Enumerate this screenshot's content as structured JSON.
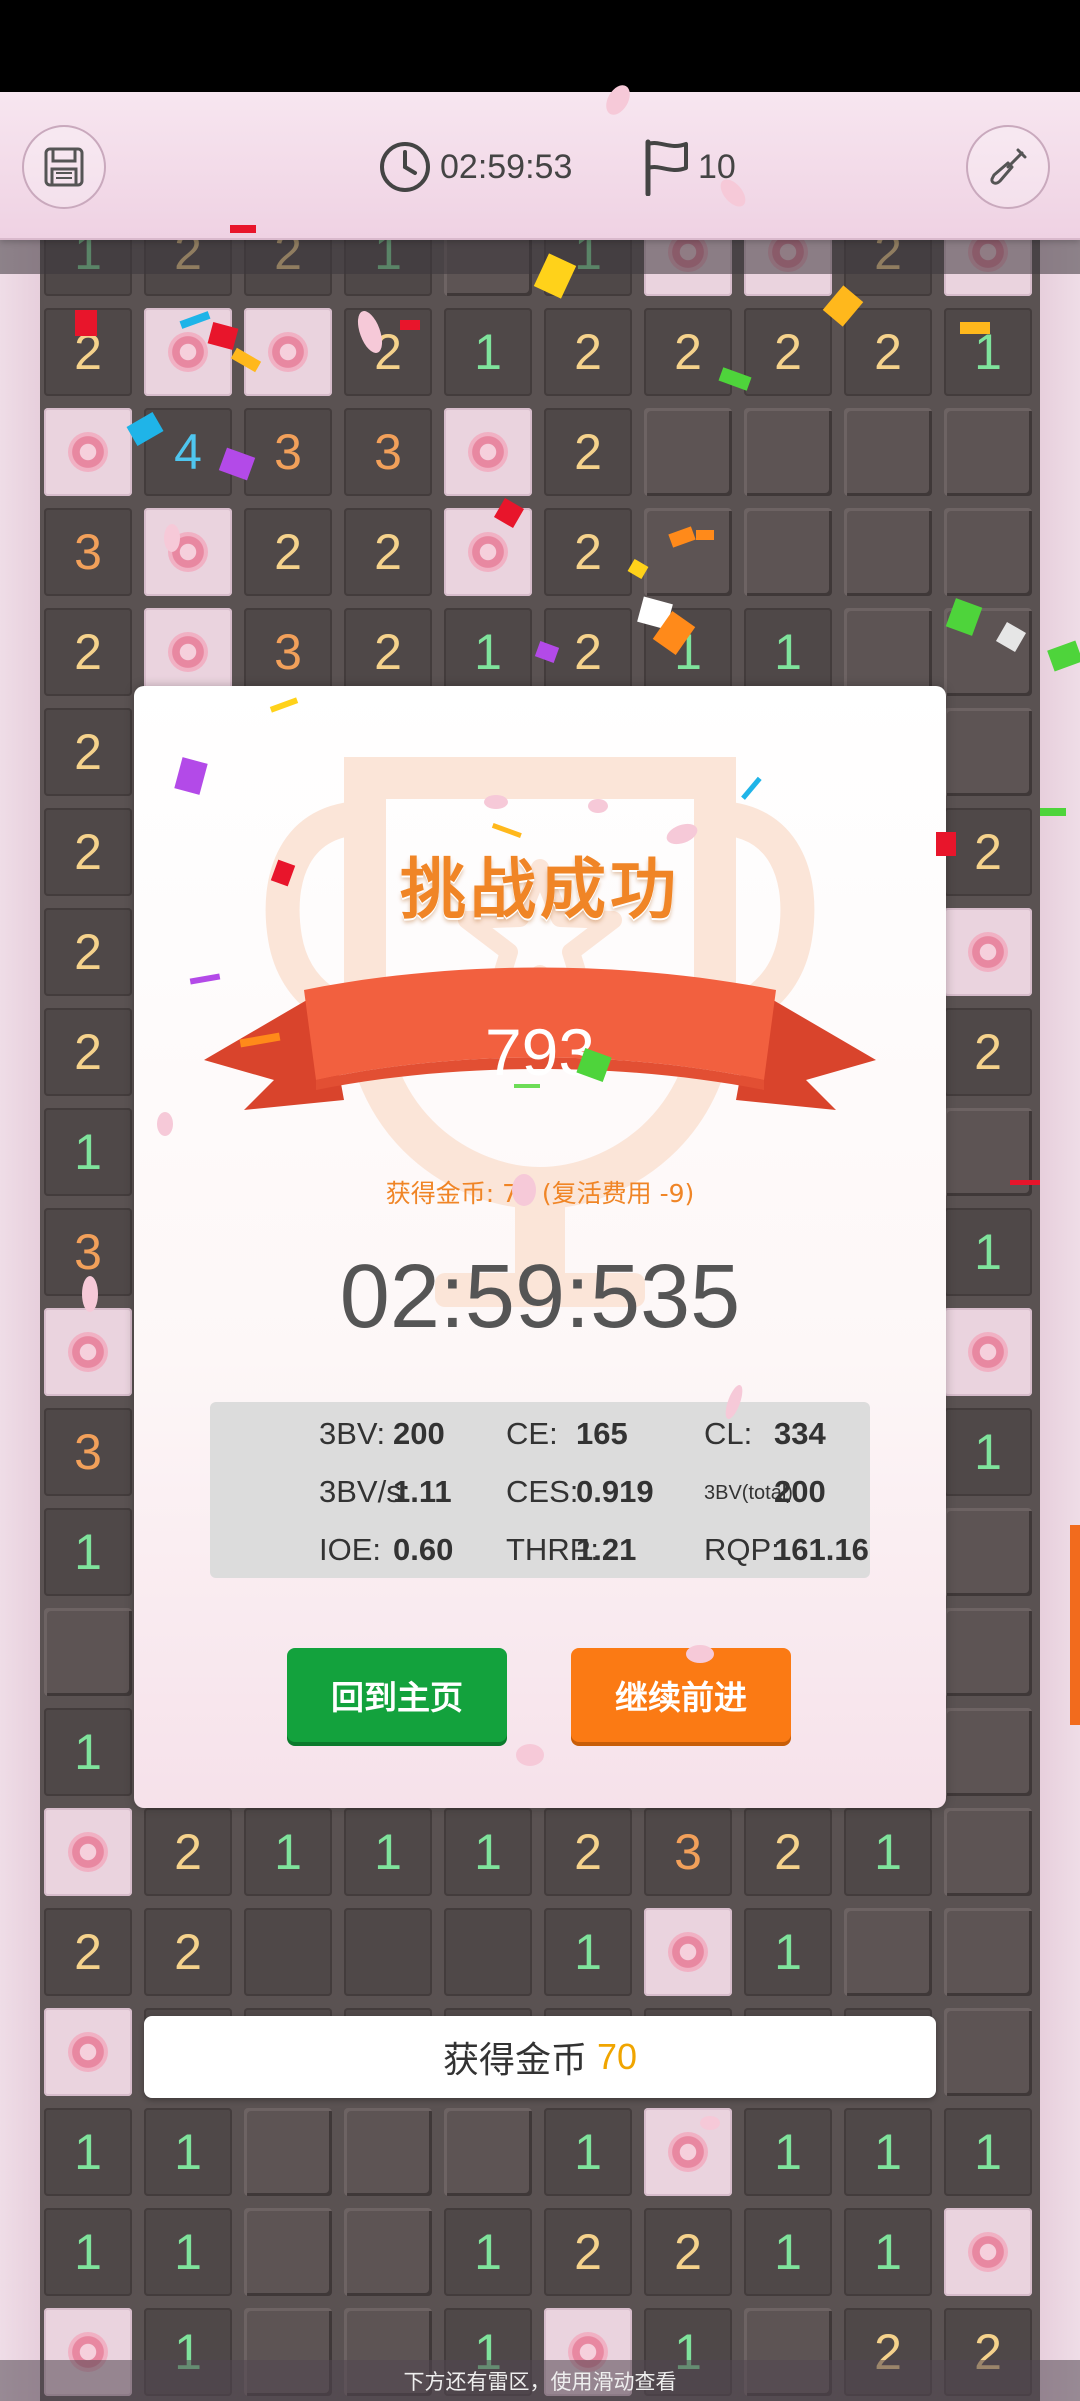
{
  "header": {
    "timer": "02:59:53",
    "flags": "10",
    "save_icon": "save-icon",
    "clock_icon": "clock-icon",
    "flag_icon": "flag-icon",
    "shovel_icon": "shovel-icon"
  },
  "board": {
    "rows": [
      [
        "1",
        "2",
        "2",
        "1",
        "",
        "1",
        "M",
        "M",
        "2",
        "M"
      ],
      [
        "2",
        "M",
        "M",
        "2",
        "1",
        "2",
        "2",
        "2",
        "2",
        "1"
      ],
      [
        "M",
        "4",
        "3",
        "3",
        "M",
        "2",
        "",
        "",
        "",
        ""
      ],
      [
        "3",
        "M",
        "2",
        "2",
        "M",
        "2",
        "",
        "",
        "",
        ""
      ],
      [
        "2",
        "M",
        "3",
        "2",
        "1",
        "2",
        "1",
        "1",
        "",
        ""
      ],
      [
        "2",
        "",
        "",
        "",
        "",
        "",
        "",
        "",
        "",
        ""
      ],
      [
        "2",
        "",
        "",
        "",
        "",
        "",
        "",
        "",
        "",
        "2"
      ],
      [
        "2",
        "",
        "",
        "",
        "",
        "",
        "",
        "",
        "",
        "M"
      ],
      [
        "2",
        "",
        "",
        "",
        "",
        "",
        "",
        "",
        "",
        "2"
      ],
      [
        "1",
        "",
        "",
        "",
        "",
        "",
        "",
        "",
        "",
        ""
      ],
      [
        "3",
        "",
        "",
        "",
        "",
        "",
        "",
        "",
        "",
        "1"
      ],
      [
        "M",
        "",
        "",
        "",
        "",
        "",
        "",
        "",
        "",
        "M"
      ],
      [
        "3",
        "",
        "",
        "",
        "",
        "",
        "",
        "",
        "",
        "1"
      ],
      [
        "1",
        "",
        "",
        "",
        "",
        "",
        "",
        "",
        "",
        ""
      ],
      [
        "",
        "",
        "",
        "",
        "",
        "",
        "",
        "",
        "",
        ""
      ],
      [
        "1",
        "",
        "",
        "",
        "",
        "",
        "",
        "",
        "",
        ""
      ],
      [
        "M",
        "2",
        "1",
        "1",
        "1",
        "2",
        "3",
        "2",
        "1",
        ""
      ],
      [
        "2",
        "2",
        "",
        "",
        "",
        "1",
        "M",
        "1",
        "",
        ""
      ],
      [
        "M",
        "",
        "",
        "",
        "",
        "",
        "",
        "",
        "",
        ""
      ],
      [
        "1",
        "1",
        "",
        "",
        "",
        "1",
        "M",
        "1",
        "1",
        "1"
      ],
      [
        "1",
        "1",
        "",
        "",
        "1",
        "2",
        "2",
        "1",
        "1",
        "M"
      ],
      [
        "M",
        "1",
        "",
        "",
        "1",
        "M",
        "1",
        "",
        "2",
        "2"
      ]
    ],
    "closed": [
      [
        0,
        4
      ],
      [
        2,
        6
      ],
      [
        2,
        7
      ],
      [
        2,
        8
      ],
      [
        2,
        9
      ],
      [
        3,
        6
      ],
      [
        3,
        7
      ],
      [
        3,
        8
      ],
      [
        3,
        9
      ],
      [
        4,
        8
      ],
      [
        4,
        9
      ],
      [
        5,
        9
      ],
      [
        9,
        9
      ],
      [
        13,
        9
      ],
      [
        14,
        0
      ],
      [
        14,
        9
      ],
      [
        15,
        9
      ],
      [
        16,
        9
      ],
      [
        17,
        8
      ],
      [
        17,
        9
      ],
      [
        18,
        9
      ],
      [
        19,
        2
      ],
      [
        19,
        3
      ],
      [
        19,
        4
      ],
      [
        20,
        2
      ],
      [
        20,
        3
      ],
      [
        21,
        2
      ],
      [
        21,
        3
      ],
      [
        21,
        7
      ]
    ]
  },
  "colors": {
    "num1": "#7fe39c",
    "num2": "#f5d28c",
    "num3": "#f2a05a",
    "num4": "#4fc6ef",
    "accent_orange": "#f08526",
    "ribbon": "#f15a3b",
    "green_button": "#13a23d",
    "orange_button": "#fb7a14"
  },
  "modal": {
    "title": "挑战成功",
    "score": "793",
    "coins_line": "获得金币: 70 (复活费用 -9)",
    "final_time": "02:59:535",
    "stats": {
      "bbbv_label": "3BV:",
      "bbbv": "200",
      "ce_label": "CE:",
      "ce": "165",
      "cl_label": "CL:",
      "cl": "334",
      "bbbvs_label": "3BV/s:",
      "bbbvs": "1.11",
      "ces_label": "CES:",
      "ces": "0.919",
      "bbbv_total_label": "3BV(total):",
      "bbbv_total": "200",
      "ioe_label": "IOE:",
      "ioe": "0.60",
      "thrp_label": "THRP:",
      "thrp": "1.21",
      "rqp_label": "RQP:",
      "rqp": "161.16"
    },
    "home_button": "回到主页",
    "continue_button": "继续前进"
  },
  "toast": {
    "label": "获得金币",
    "amount": "70"
  },
  "footer_hint": "下方还有雷区，使用滑动查看"
}
